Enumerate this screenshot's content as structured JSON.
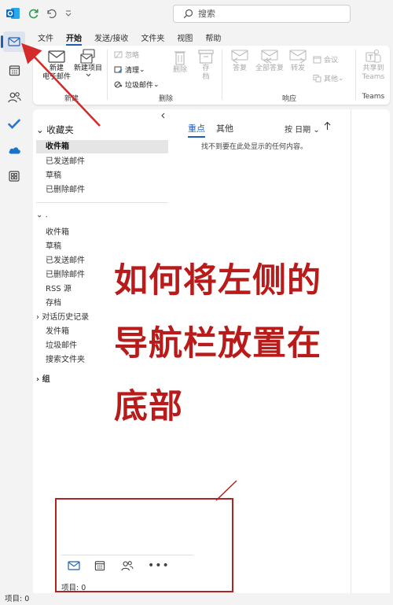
{
  "search": {
    "placeholder": "搜索"
  },
  "ribbon": {
    "tabs": [
      {
        "label": "文件"
      },
      {
        "label": "开始"
      },
      {
        "label": "发送/接收"
      },
      {
        "label": "文件夹"
      },
      {
        "label": "视图"
      },
      {
        "label": "帮助"
      }
    ],
    "new_email": {
      "line1": "新建",
      "line2": "电子邮件"
    },
    "new_item": {
      "line1": "新建项目"
    },
    "group_new": "新建",
    "ignore": "忽略",
    "cleanup": "清理",
    "junk": "垃圾邮件",
    "delete": "删除",
    "archive": {
      "line1": "存",
      "line2": "档"
    },
    "group_delete": "删除",
    "reply": "答复",
    "reply_all": "全部答复",
    "forward": "转发",
    "meeting": "会议",
    "more": "其他",
    "group_respond": "响应",
    "share_teams": {
      "line1": "共享到",
      "line2": "Teams"
    },
    "group_teams": "Teams"
  },
  "folders": {
    "favorites_label": "收藏夹",
    "favorites": [
      {
        "label": "收件箱"
      },
      {
        "label": "已发送邮件"
      },
      {
        "label": "草稿"
      },
      {
        "label": "已删除邮件"
      }
    ],
    "account_label": ".",
    "account": [
      {
        "label": "收件箱"
      },
      {
        "label": "草稿"
      },
      {
        "label": "已发送邮件"
      },
      {
        "label": "已删除邮件"
      },
      {
        "label": "RSS 源"
      },
      {
        "label": "存档"
      },
      {
        "label": "对话历史记录"
      },
      {
        "label": "发件箱"
      },
      {
        "label": "垃圾邮件"
      },
      {
        "label": "搜索文件夹"
      }
    ],
    "groups_label": "组"
  },
  "message_list": {
    "tab_focused": "重点",
    "tab_other": "其他",
    "sort_label": "按 日期",
    "empty_text": "找不到要在此处显示的任何内容。"
  },
  "annotation": {
    "line1": "如何将左侧的",
    "line2": "导航栏放置在",
    "line3": "底部"
  },
  "inset": {
    "status": "项目: 0"
  },
  "status_bar": {
    "items": "项目: 0"
  },
  "colors": {
    "accent": "#1f5fb4",
    "annotation_red": "#b91b1b",
    "outlook_blue": "#0f6cbd"
  }
}
